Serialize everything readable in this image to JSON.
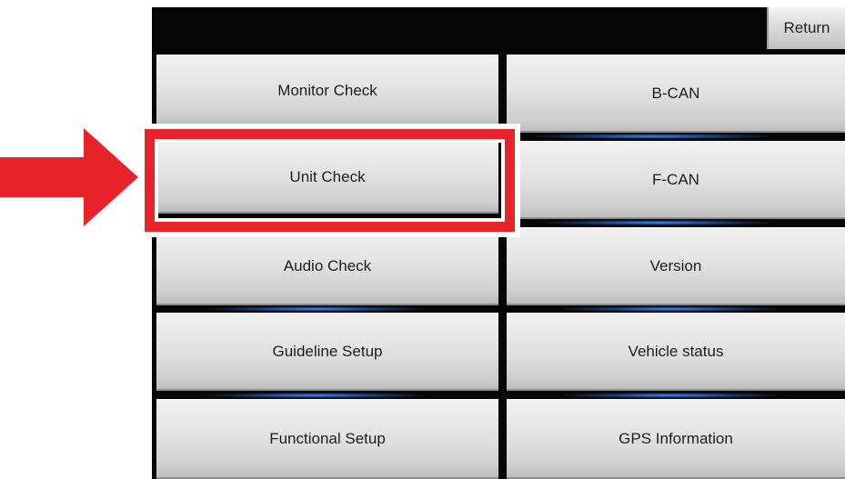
{
  "header": {
    "return_label": "Return"
  },
  "menu": {
    "left": [
      {
        "label": "Monitor Check"
      },
      {
        "label": "Unit Check"
      },
      {
        "label": "Audio Check"
      },
      {
        "label": "Guideline Setup"
      },
      {
        "label": "Functional Setup"
      }
    ],
    "right": [
      {
        "label": "B-CAN"
      },
      {
        "label": "F-CAN"
      },
      {
        "label": "Version"
      },
      {
        "label": "Vehicle status"
      },
      {
        "label": "GPS Information"
      }
    ]
  },
  "annotation": {
    "highlight_color": "#e8232a",
    "arrow_color": "#e8232a",
    "arrow_icon": "arrow-right-icon"
  }
}
